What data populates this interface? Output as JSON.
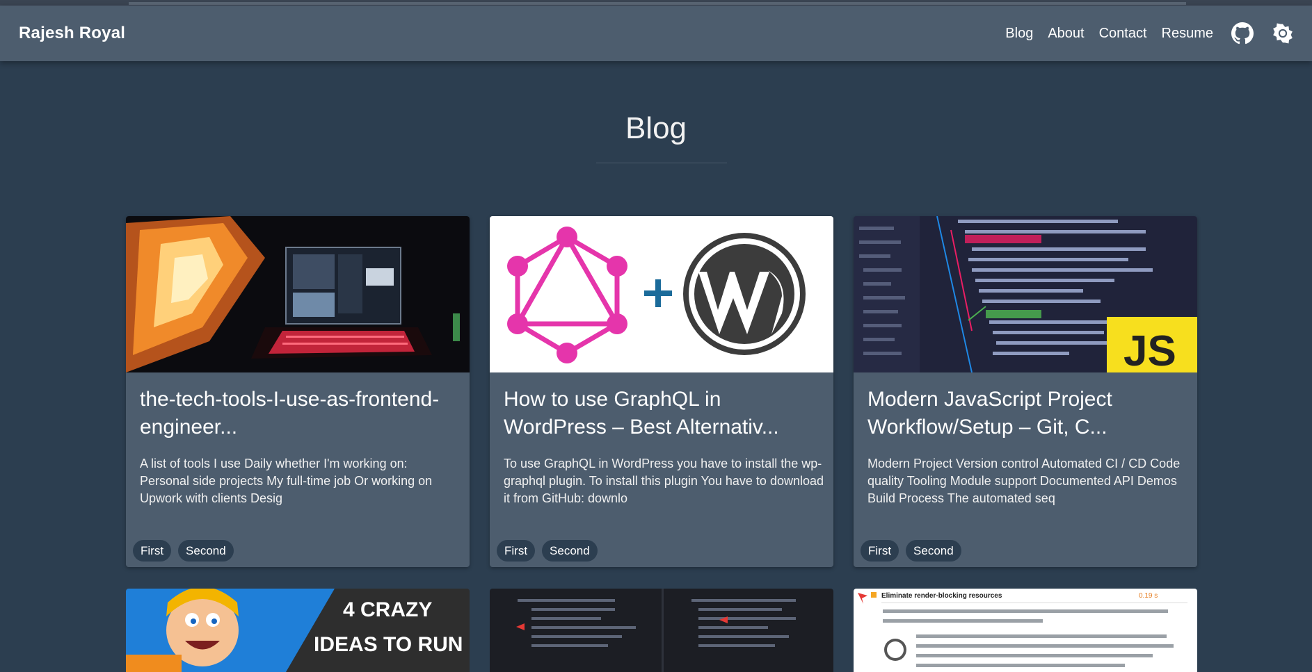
{
  "navbar": {
    "brand": "Rajesh Royal",
    "links": [
      "Blog",
      "About",
      "Contact",
      "Resume"
    ],
    "icons": [
      "github-icon",
      "theme-toggle-icon"
    ]
  },
  "page": {
    "title": "Blog"
  },
  "posts": [
    {
      "title": "the-tech-tools-I-use-as-frontend-engineer...",
      "description": "A list of tools I use Daily whether I'm working on: Personal side projects My full-time job Or working on Upwork with clients Desig",
      "tags": [
        "First",
        "Second"
      ]
    },
    {
      "title": "How to use GraphQL in WordPress – Best Alternativ...",
      "description": "To use GraphQL in WordPress you have to install the wp-graphql plugin. To install this plugin You have to download it from GitHub: downlo",
      "tags": [
        "First",
        "Second"
      ]
    },
    {
      "title": "Modern JavaScript Project Workflow/Setup – Git, C...",
      "description": "Modern Project Version control Automated CI / CD Code quality Tooling Module support Documented API Demos Build Process The automated seq",
      "tags": [
        "First",
        "Second"
      ]
    }
  ],
  "next_posts_preview": [
    {
      "image_text_line1": "4 CRAZY",
      "image_text_line2": "IDEAS TO RUN"
    },
    {},
    {
      "image_heading": "Eliminate render-blocking resources",
      "image_value": "0.19 s"
    }
  ],
  "colors": {
    "background": "#2c3e50",
    "navbar": "#4d5d6e",
    "card": "#4d5d6e",
    "tag": "#2c3e50",
    "graphql_pink": "#e535ab",
    "js_yellow": "#f7df1e"
  }
}
